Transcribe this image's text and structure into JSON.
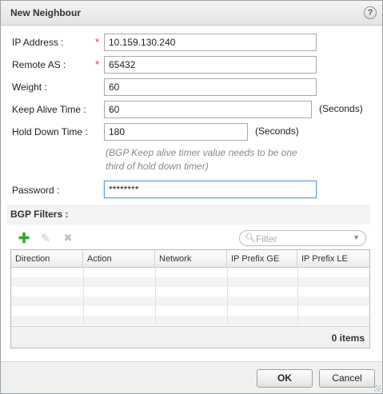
{
  "dialog": {
    "title": "New Neighbour",
    "help_symbol": "?"
  },
  "form": {
    "ip_address": {
      "label": "IP Address :",
      "value": "10.159.130.240",
      "required": true
    },
    "remote_as": {
      "label": "Remote AS :",
      "value": "65432",
      "required": true
    },
    "weight": {
      "label": "Weight :",
      "value": "60"
    },
    "keep_alive": {
      "label": "Keep Alive Time :",
      "value": "60",
      "unit": "(Seconds)"
    },
    "hold_down": {
      "label": "Hold Down Time :",
      "value": "180",
      "unit": "(Seconds)"
    },
    "hint_line1": "(BGP Keep alive timer value needs to be one",
    "hint_line2": "third of hold down timer)",
    "password": {
      "label": "Password :",
      "value": "********"
    },
    "required_marker": "*"
  },
  "bgp_filters": {
    "title": "BGP Filters :",
    "toolbar": {
      "add_icon": "add-icon",
      "edit_icon": "edit-icon",
      "delete_icon": "delete-icon"
    },
    "filter_placeholder": "Filter",
    "columns": [
      "Direction",
      "Action",
      "Network",
      "IP Prefix GE",
      "IP Prefix LE"
    ],
    "rows": [],
    "count_text": "0 items"
  },
  "buttons": {
    "ok": "OK",
    "cancel": "Cancel"
  },
  "colors": {
    "required": "#e0402a",
    "add_icon": "#2ea52e",
    "focus_border": "#5aa0d8"
  }
}
